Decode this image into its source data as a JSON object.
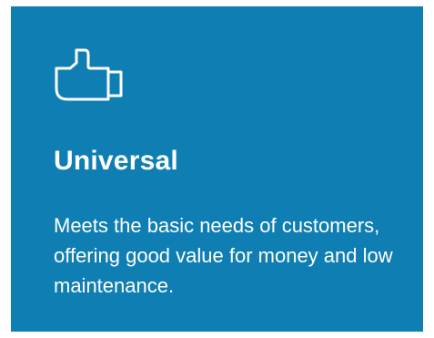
{
  "card": {
    "icon": "thumbs-up-icon",
    "title": "Universal",
    "description": "Meets the basic needs of customers, offering good value for money and low maintenance.",
    "background_color": "#0f7fb3",
    "text_color": "#ffffff"
  }
}
